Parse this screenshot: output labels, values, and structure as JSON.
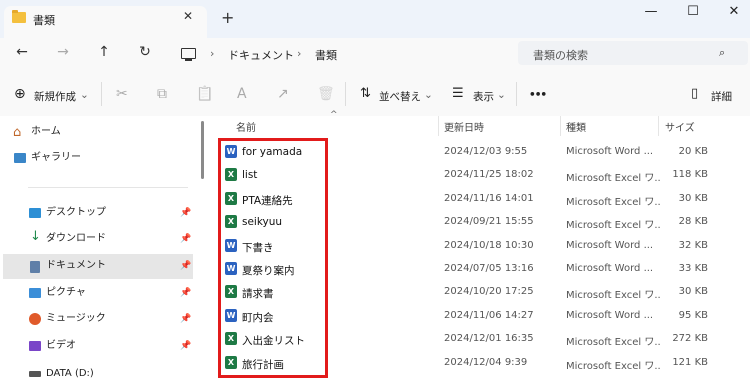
{
  "tab": {
    "title": "書類",
    "close": "✕",
    "new_tab": "+"
  },
  "window": {
    "minimize": "—",
    "maximize": "☐",
    "close": "✕"
  },
  "nav": {
    "back": "←",
    "forward": "→",
    "up": "↑",
    "refresh": "↻"
  },
  "address": {
    "sep": "›",
    "crumbs": [
      "ドキュメント",
      "書類"
    ]
  },
  "search": {
    "placeholder": "書類の検索",
    "icon": "⌕"
  },
  "toolbar": {
    "new_label": "新規作成",
    "new_icon": "⊕",
    "new_caret": "⌄",
    "sort_label": "並べ替え",
    "sort_icon": "⇅",
    "sort_caret": "⌄",
    "view_label": "表示",
    "view_icon": "☰",
    "view_caret": "⌄",
    "more": "•••",
    "details_label": "詳細",
    "details_icon": "▯",
    "cut": "✂",
    "copy": "⧉",
    "paste": "📋",
    "rename": "A",
    "share": "↗",
    "delete": "🗑"
  },
  "sidebar": {
    "items": [
      {
        "label": "ホーム"
      },
      {
        "label": "ギャラリー"
      },
      {
        "label": "デスクトップ"
      },
      {
        "label": "ダウンロード"
      },
      {
        "label": "ドキュメント"
      },
      {
        "label": "ピクチャ"
      },
      {
        "label": "ミュージック"
      },
      {
        "label": "ビデオ"
      },
      {
        "label": "DATA (D:)"
      }
    ],
    "pin": "📌"
  },
  "columns": {
    "name": "名前",
    "date": "更新日時",
    "type": "種類",
    "size": "サイズ",
    "sort_indicator": "^"
  },
  "files": [
    {
      "name": "for yamada",
      "date": "2024/12/03 9:55",
      "type": "Microsoft Word ...",
      "size": "20 KB",
      "kind": "W"
    },
    {
      "name": "list",
      "date": "2024/11/25 18:02",
      "type": "Microsoft Excel ワ...",
      "size": "118 KB",
      "kind": "X"
    },
    {
      "name": "PTA連絡先",
      "date": "2024/11/16 14:01",
      "type": "Microsoft Excel ワ...",
      "size": "30 KB",
      "kind": "X"
    },
    {
      "name": "seikyuu",
      "date": "2024/09/21 15:55",
      "type": "Microsoft Excel ワ...",
      "size": "28 KB",
      "kind": "X"
    },
    {
      "name": "下書き",
      "date": "2024/10/18 10:30",
      "type": "Microsoft Word ...",
      "size": "32 KB",
      "kind": "W"
    },
    {
      "name": "夏祭り案内",
      "date": "2024/07/05 13:16",
      "type": "Microsoft Word ...",
      "size": "33 KB",
      "kind": "W"
    },
    {
      "name": "請求書",
      "date": "2024/10/20 17:25",
      "type": "Microsoft Excel ワ...",
      "size": "30 KB",
      "kind": "X"
    },
    {
      "name": "町内会",
      "date": "2024/11/06 14:27",
      "type": "Microsoft Word ...",
      "size": "95 KB",
      "kind": "W"
    },
    {
      "name": "入出金リスト",
      "date": "2024/12/01 16:35",
      "type": "Microsoft Excel ワ...",
      "size": "272 KB",
      "kind": "X"
    },
    {
      "name": "旅行計画",
      "date": "2024/12/04 9:39",
      "type": "Microsoft Excel ワ...",
      "size": "121 KB",
      "kind": "X"
    }
  ],
  "colors": {
    "highlight_box": "#e21b1b",
    "word": "#2b62c0",
    "excel": "#1e7a45",
    "folder": "#f4c03e"
  }
}
